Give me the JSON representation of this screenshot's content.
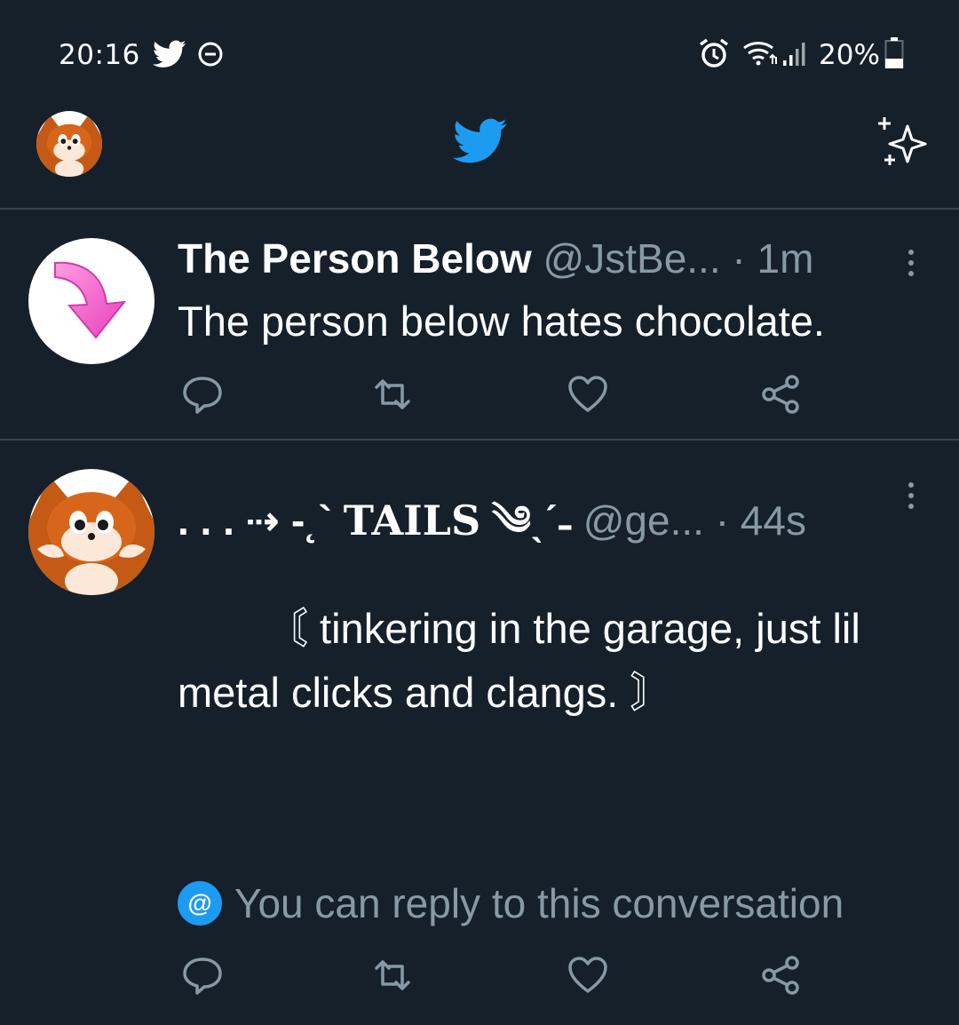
{
  "status_bar": {
    "time": "20:16",
    "battery": "20%",
    "icons": [
      "twitter-bird-icon",
      "do-not-disturb-icon",
      "alarm-icon",
      "wifi-icon",
      "signal-icon",
      "battery-icon"
    ]
  },
  "header": {
    "avatar_icon": "fox-avatar",
    "logo_icon": "twitter-bird-icon",
    "right_icon": "sparkle-icon"
  },
  "tweets": [
    {
      "name": "The Person Below",
      "handle": "@JstBe...",
      "separator": "·",
      "time": "1m",
      "text": "The person below hates chocolate.",
      "avatar_icon": "pink-down-arrow"
    },
    {
      "name_prefix": ". . . ⇢ -˛`",
      "name": "TAILS",
      "name_suffix": "༄ˎˊ˗",
      "handle": "@ge...",
      "separator": "·",
      "time": "44s",
      "text": "〘 tinkering in the garage, just lil metal clicks and clangs. 〙",
      "avatar_icon": "fox-avatar"
    }
  ],
  "reply_note": {
    "at": "@",
    "text": "You can reply to this conversation"
  },
  "colors": {
    "background": "#15202b",
    "divider": "#38444d",
    "muted": "#8899a6",
    "accent": "#1d9bf0"
  }
}
